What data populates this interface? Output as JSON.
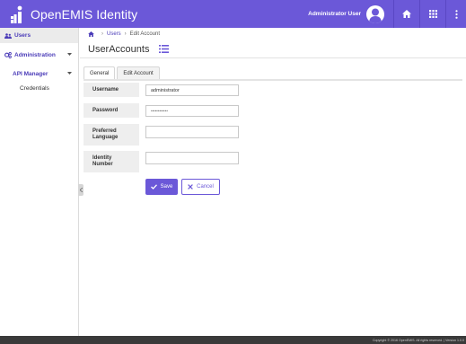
{
  "header": {
    "brand": "OpenEMIS Identity",
    "user_name": "Administrator User",
    "colors": {
      "primary": "#6b58d8",
      "sidebar_text": "#4a3bb8"
    }
  },
  "sidebar": {
    "users": "Users",
    "administration": "Administration",
    "api_manager": "API Manager",
    "credentials": "Credentials"
  },
  "breadcrumb": {
    "users": "Users",
    "current": "Edit Account"
  },
  "page": {
    "title": "UserAccounts"
  },
  "tabs": [
    {
      "label": "General"
    },
    {
      "label": "Edit Account"
    }
  ],
  "form": {
    "username_label": "Username",
    "username_value": "administrator",
    "password_label": "Password",
    "password_value": "••••••••••••",
    "language_label": "Preferred Language",
    "language_value": "",
    "identity_label": "Identity Number",
    "identity_value": ""
  },
  "actions": {
    "save": "Save",
    "cancel": "Cancel"
  },
  "footer": {
    "text": "Copyright © 2016 OpenEMIS. All rights reserved. | Version 1.0.0"
  }
}
